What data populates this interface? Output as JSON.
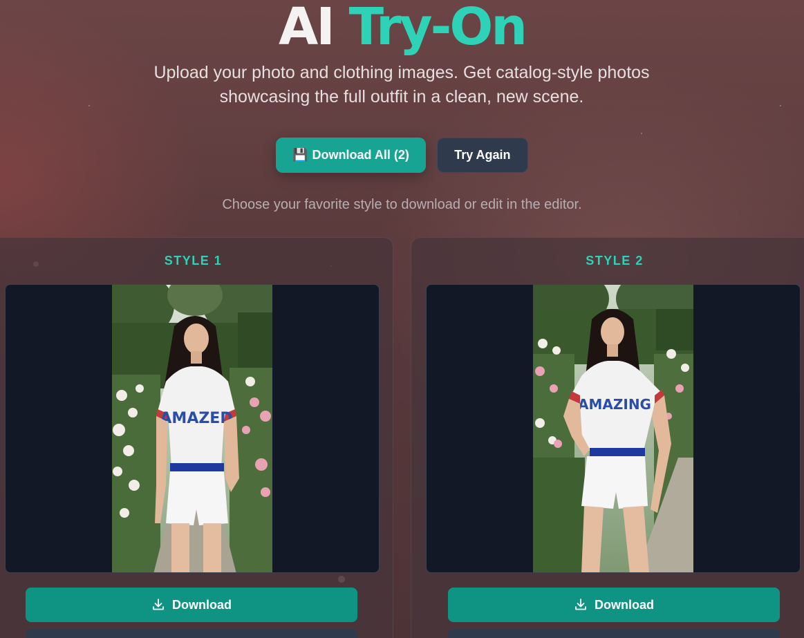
{
  "header": {
    "title_part1": "AI",
    "title_part2": "Try-On",
    "subtitle_line1": "Upload your photo and clothing images. Get catalog-style photos",
    "subtitle_line2": "showcasing the full outfit in a clean, new scene."
  },
  "actions": {
    "download_all_icon": "💾",
    "download_all_label": "Download All (2)",
    "try_again_label": "Try Again"
  },
  "hint": "Choose your favorite style to download or edit in the editor.",
  "results": [
    {
      "label": "STYLE 1",
      "image_alt": "Woman in white baseball jersey reading AMAZED and white shorts with blue belt, standing in a rose garden",
      "jersey_text": "AMAZED",
      "download_label": "Download"
    },
    {
      "label": "STYLE 2",
      "image_alt": "Woman in white baseball jersey reading AMAZING and white shorts with blue belt, hand on hip in a rose garden",
      "jersey_text": "AMAZING",
      "download_label": "Download"
    }
  ],
  "colors": {
    "accent": "#2ed3b7",
    "button_primary": "#17a493",
    "button_secondary": "#2f3a4c",
    "image_frame_bg": "#121826"
  },
  "icons": {
    "download": "download-icon",
    "save": "floppy-disk-icon"
  }
}
